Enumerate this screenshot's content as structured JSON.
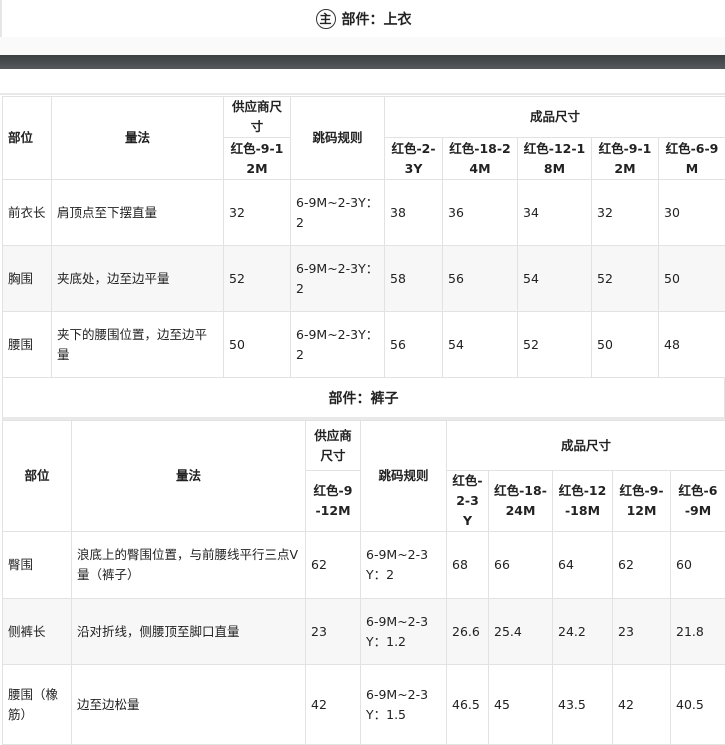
{
  "section1": {
    "badge": "主",
    "title": "部件：上衣"
  },
  "section2": {
    "title": "部件：裤子"
  },
  "headers": {
    "part": "部位",
    "method": "量法",
    "supplier": "供应商尺寸",
    "rule": "跳码规则",
    "finished": "成品尺寸",
    "sizes": [
      "红色-2-3Y",
      "红色-18-24M",
      "红色-12-18M",
      "红色-9-12M",
      "红色-6-9M"
    ],
    "supplier_size": "红色-9-12M"
  },
  "top_rows": [
    {
      "part": "前衣长",
      "method": "肩顶点至下摆直量",
      "supplier": "32",
      "rule": "6-9M~2-3Y：2",
      "values": [
        "38",
        "36",
        "34",
        "32",
        "30"
      ]
    },
    {
      "part": "胸围",
      "method": "夹底处，边至边平量",
      "supplier": "52",
      "rule": "6-9M~2-3Y：2",
      "values": [
        "58",
        "56",
        "54",
        "52",
        "50"
      ]
    },
    {
      "part": "腰围",
      "method": "夹下的腰围位置，边至边平量",
      "supplier": "50",
      "rule": "6-9M~2-3Y：2",
      "values": [
        "56",
        "54",
        "52",
        "50",
        "48"
      ]
    }
  ],
  "pants_rows": [
    {
      "part": "臀围",
      "method": "浪底上的臀围位置，与前腰线平行三点V量（裤子）",
      "supplier": "62",
      "rule": "6-9M~2-3Y：2",
      "values": [
        "68",
        "66",
        "64",
        "62",
        "60"
      ]
    },
    {
      "part": "侧裤长",
      "method": "沿对折线，侧腰顶至脚口直量",
      "supplier": "23",
      "rule": "6-9M~2-3Y：1.2",
      "values": [
        "26.6",
        "25.4",
        "24.2",
        "23",
        "21.8"
      ]
    },
    {
      "part": "腰围（橡筋）",
      "method": "边至边松量",
      "supplier": "42",
      "rule": "6-9M~2-3Y：1.5",
      "values": [
        "46.5",
        "45",
        "43.5",
        "42",
        "40.5"
      ]
    }
  ]
}
